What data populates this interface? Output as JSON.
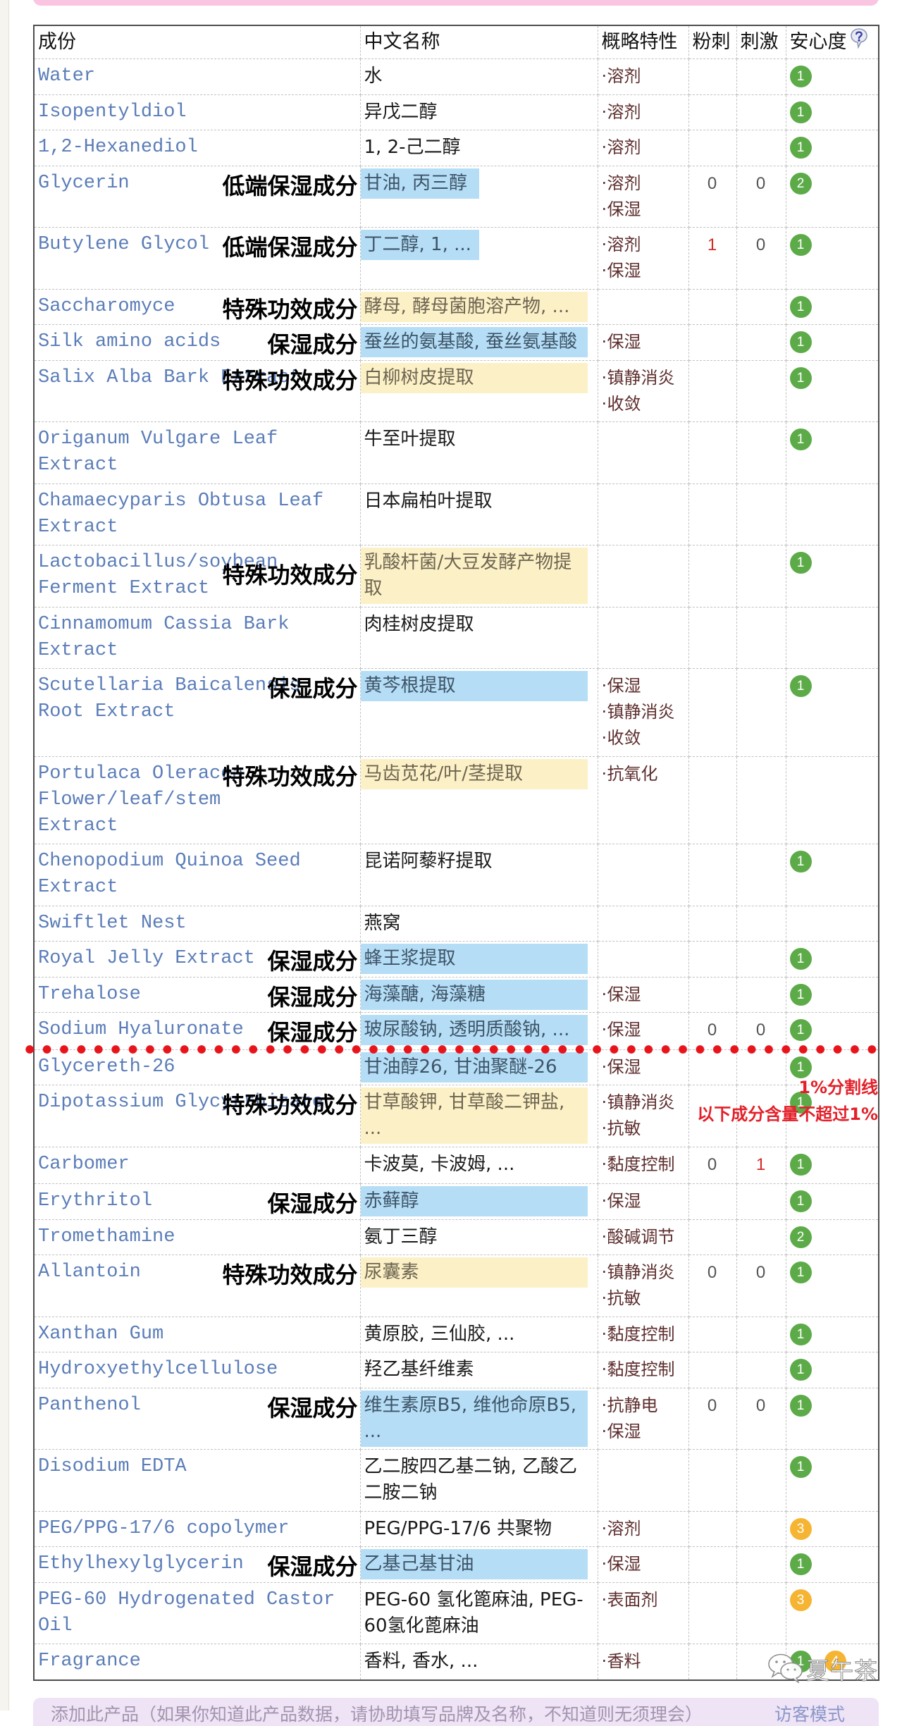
{
  "table": {
    "headers": {
      "ingredient": "成份",
      "chinese_name": "中文名称",
      "properties": "概略特性",
      "acne": "粉刺",
      "irritation": "刺激",
      "safety": "安心度"
    },
    "help_icon": "question-bubble-icon",
    "property_bullet": "·",
    "rows": [
      {
        "ingredient": "Water",
        "chinese_name": "水",
        "properties": [
          "溶剂"
        ],
        "acne": null,
        "irritation": null,
        "safety": [
          1
        ],
        "annotation": null,
        "highlight": null
      },
      {
        "ingredient": "Isopentyldiol",
        "chinese_name": "异戊二醇",
        "properties": [
          "溶剂"
        ],
        "acne": null,
        "irritation": null,
        "safety": [
          1
        ],
        "annotation": null,
        "highlight": null
      },
      {
        "ingredient": "1,2-Hexanediol",
        "chinese_name": "1, 2-己二醇",
        "properties": [
          "溶剂"
        ],
        "acne": null,
        "irritation": null,
        "safety": [
          1
        ],
        "annotation": null,
        "highlight": null
      },
      {
        "ingredient": "Glycerin",
        "chinese_name": "甘油, 丙三醇",
        "properties": [
          "溶剂",
          "保湿"
        ],
        "acne": 0,
        "irritation": 0,
        "safety": [
          2
        ],
        "annotation": "低端保湿成分",
        "highlight": "blue"
      },
      {
        "ingredient": "Butylene Glycol",
        "chinese_name": "丁二醇, 1, ...",
        "properties": [
          "溶剂",
          "保湿"
        ],
        "acne": 1,
        "irritation": 0,
        "safety": [
          1
        ],
        "annotation": "低端保湿成分",
        "highlight": "blue"
      },
      {
        "ingredient": "Saccharomyce",
        "chinese_name": "酵母, 酵母菌胞溶产物, ...",
        "properties": [],
        "acne": null,
        "irritation": null,
        "safety": [
          1
        ],
        "annotation": "特殊功效成分",
        "highlight": "yellow"
      },
      {
        "ingredient": "Silk amino acids",
        "chinese_name": "蚕丝的氨基酸, 蚕丝氨基酸",
        "properties": [
          "保湿"
        ],
        "acne": null,
        "irritation": null,
        "safety": [
          1
        ],
        "annotation": "保湿成分",
        "highlight": "blue"
      },
      {
        "ingredient": "Salix Alba Bark Extract",
        "chinese_name": "白柳树皮提取",
        "properties": [
          "镇静消炎",
          "收敛"
        ],
        "acne": null,
        "irritation": null,
        "safety": [
          1
        ],
        "annotation": "特殊功效成分",
        "highlight": "yellow"
      },
      {
        "ingredient": "Origanum Vulgare Leaf Extract",
        "chinese_name": "牛至叶提取",
        "properties": [],
        "acne": null,
        "irritation": null,
        "safety": [
          1
        ],
        "annotation": null,
        "highlight": null
      },
      {
        "ingredient": "Chamaecyparis Obtusa Leaf Extract",
        "chinese_name": "日本扁柏叶提取",
        "properties": [],
        "acne": null,
        "irritation": null,
        "safety": [],
        "annotation": null,
        "highlight": null
      },
      {
        "ingredient": "Lactobacillus/soybean Ferment Extract",
        "chinese_name": "乳酸杆菌/大豆发酵产物提取",
        "properties": [],
        "acne": null,
        "irritation": null,
        "safety": [
          1
        ],
        "annotation": "特殊功效成分",
        "highlight": "yellow"
      },
      {
        "ingredient": "Cinnamomum Cassia Bark Extract",
        "chinese_name": "肉桂树皮提取",
        "properties": [],
        "acne": null,
        "irritation": null,
        "safety": [],
        "annotation": null,
        "highlight": null
      },
      {
        "ingredient": "Scutellaria Baicalensis Root Extract",
        "chinese_name": "黄芩根提取",
        "properties": [
          "保湿",
          "镇静消炎",
          "收敛"
        ],
        "acne": null,
        "irritation": null,
        "safety": [
          1
        ],
        "annotation": "保湿成分",
        "highlight": "blue"
      },
      {
        "ingredient": "Portulaca Oleracea Flower/leaf/stem Extract",
        "chinese_name": "马齿苋花/叶/茎提取",
        "properties": [
          "抗氧化"
        ],
        "acne": null,
        "irritation": null,
        "safety": [],
        "annotation": "特殊功效成分",
        "highlight": "yellow"
      },
      {
        "ingredient": "Chenopodium Quinoa Seed Extract",
        "chinese_name": "昆诺阿藜籽提取",
        "properties": [],
        "acne": null,
        "irritation": null,
        "safety": [
          1
        ],
        "annotation": null,
        "highlight": null
      },
      {
        "ingredient": "Swiftlet Nest",
        "chinese_name": "燕窝",
        "properties": [],
        "acne": null,
        "irritation": null,
        "safety": [],
        "annotation": null,
        "highlight": null
      },
      {
        "ingredient": "Royal Jelly Extract",
        "chinese_name": "蜂王浆提取",
        "properties": [],
        "acne": null,
        "irritation": null,
        "safety": [
          1
        ],
        "annotation": "保湿成分",
        "highlight": "blue"
      },
      {
        "ingredient": "Trehalose",
        "chinese_name": "海藻醣, 海藻糖",
        "properties": [
          "保湿"
        ],
        "acne": null,
        "irritation": null,
        "safety": [
          1
        ],
        "annotation": "保湿成分",
        "highlight": "blue"
      },
      {
        "ingredient": "Sodium Hyaluronate",
        "chinese_name": "玻尿酸钠, 透明质酸钠, ...",
        "properties": [
          "保湿"
        ],
        "acne": 0,
        "irritation": 0,
        "safety": [
          1
        ],
        "annotation": "保湿成分",
        "highlight": "blue"
      },
      {
        "ingredient": "Glycereth-26",
        "chinese_name": "甘油醇26, 甘油聚醚-26",
        "properties": [
          "保湿"
        ],
        "acne": null,
        "irritation": null,
        "safety": [
          1
        ],
        "annotation": null,
        "highlight": "blue"
      },
      {
        "ingredient": "Dipotassium Glycyrrhizate",
        "chinese_name": "甘草酸钾, 甘草酸二钾盐, ...",
        "properties": [
          "镇静消炎",
          "抗敏"
        ],
        "acne": null,
        "irritation": null,
        "safety": [
          1
        ],
        "annotation": "特殊功效成分",
        "highlight": "yellow"
      },
      {
        "ingredient": "Carbomer",
        "chinese_name": "卡波莫, 卡波姆, ...",
        "properties": [
          "黏度控制"
        ],
        "acne": 0,
        "irritation": 1,
        "safety": [
          1
        ],
        "annotation": null,
        "highlight": null
      },
      {
        "ingredient": "Erythritol",
        "chinese_name": "赤藓醇",
        "properties": [
          "保湿"
        ],
        "acne": null,
        "irritation": null,
        "safety": [
          1
        ],
        "annotation": "保湿成分",
        "highlight": "blue"
      },
      {
        "ingredient": "Tromethamine",
        "chinese_name": "氨丁三醇",
        "properties": [
          "酸碱调节"
        ],
        "acne": null,
        "irritation": null,
        "safety": [
          2
        ],
        "annotation": null,
        "highlight": null
      },
      {
        "ingredient": "Allantoin",
        "chinese_name": "尿囊素",
        "properties": [
          "镇静消炎",
          "抗敏"
        ],
        "acne": 0,
        "irritation": 0,
        "safety": [
          1
        ],
        "annotation": "特殊功效成分",
        "highlight": "yellow"
      },
      {
        "ingredient": "Xanthan Gum",
        "chinese_name": "黄原胶, 三仙胶, ...",
        "properties": [
          "黏度控制"
        ],
        "acne": null,
        "irritation": null,
        "safety": [
          1
        ],
        "annotation": null,
        "highlight": null
      },
      {
        "ingredient": "Hydroxyethylcellulose",
        "chinese_name": "羟乙基纤维素",
        "properties": [
          "黏度控制"
        ],
        "acne": null,
        "irritation": null,
        "safety": [
          1
        ],
        "annotation": null,
        "highlight": null
      },
      {
        "ingredient": "Panthenol",
        "chinese_name": "维生素原B5, 维他命原B5, ...",
        "properties": [
          "抗静电",
          "保湿"
        ],
        "acne": 0,
        "irritation": 0,
        "safety": [
          1
        ],
        "annotation": "保湿成分",
        "highlight": "blue"
      },
      {
        "ingredient": "Disodium EDTA",
        "chinese_name": "乙二胺四乙基二钠, 乙酸乙二胺二钠",
        "properties": [],
        "acne": null,
        "irritation": null,
        "safety": [
          1
        ],
        "annotation": null,
        "highlight": null
      },
      {
        "ingredient": "PEG/PPG-17/6 copolymer",
        "chinese_name": "PEG/PPG-17/6 共聚物",
        "properties": [
          "溶剂"
        ],
        "acne": null,
        "irritation": null,
        "safety": [
          3
        ],
        "annotation": null,
        "highlight": null
      },
      {
        "ingredient": "Ethylhexylglycerin",
        "chinese_name": "乙基己基甘油",
        "properties": [
          "保湿"
        ],
        "acne": null,
        "irritation": null,
        "safety": [
          1
        ],
        "annotation": "保湿成分",
        "highlight": "blue"
      },
      {
        "ingredient": "PEG-60 Hydrogenated Castor Oil",
        "chinese_name": "PEG-60 氢化篦麻油, PEG-60氢化蓖麻油",
        "properties": [
          "表面剂"
        ],
        "acne": null,
        "irritation": null,
        "safety": [
          3
        ],
        "annotation": null,
        "highlight": null
      },
      {
        "ingredient": "Fragrance",
        "chinese_name": "香料, 香水, ...",
        "properties": [
          "香料"
        ],
        "acne": null,
        "irritation": null,
        "safety": [
          1,
          4
        ],
        "annotation": null,
        "highlight": null
      }
    ]
  },
  "one_percent_divider": {
    "after_ingredient": "Sodium Hyaluronate",
    "label": "1%分割线",
    "note": "以下成分含量不超过1%"
  },
  "watermark": {
    "icon": "wechat-icon",
    "text": "夏午茶"
  },
  "footer": {
    "add_product_text": "添加此产品（如果你知道此产品数据，请协助填写品牌及名称，不知道则无须理会）",
    "guest_mode_label": "访客模式"
  },
  "colors": {
    "ingredient_link": "#5b7db8",
    "property_text": "#5e2e2e",
    "highlight": {
      "blue": "#b5def6",
      "yellow": "#fcf1c6"
    },
    "safety_levels": {
      "1": "#5cab48",
      "2": "#5cab48",
      "3": "#f5b532",
      "4": "#f5b532"
    },
    "count_zero": "#555555",
    "count_positive": "#d42a2a",
    "divider": "#e8141b",
    "divider_text": "#e3202a",
    "top_banner": "#f9c5e1",
    "footer_bar": "#efe3f6"
  }
}
